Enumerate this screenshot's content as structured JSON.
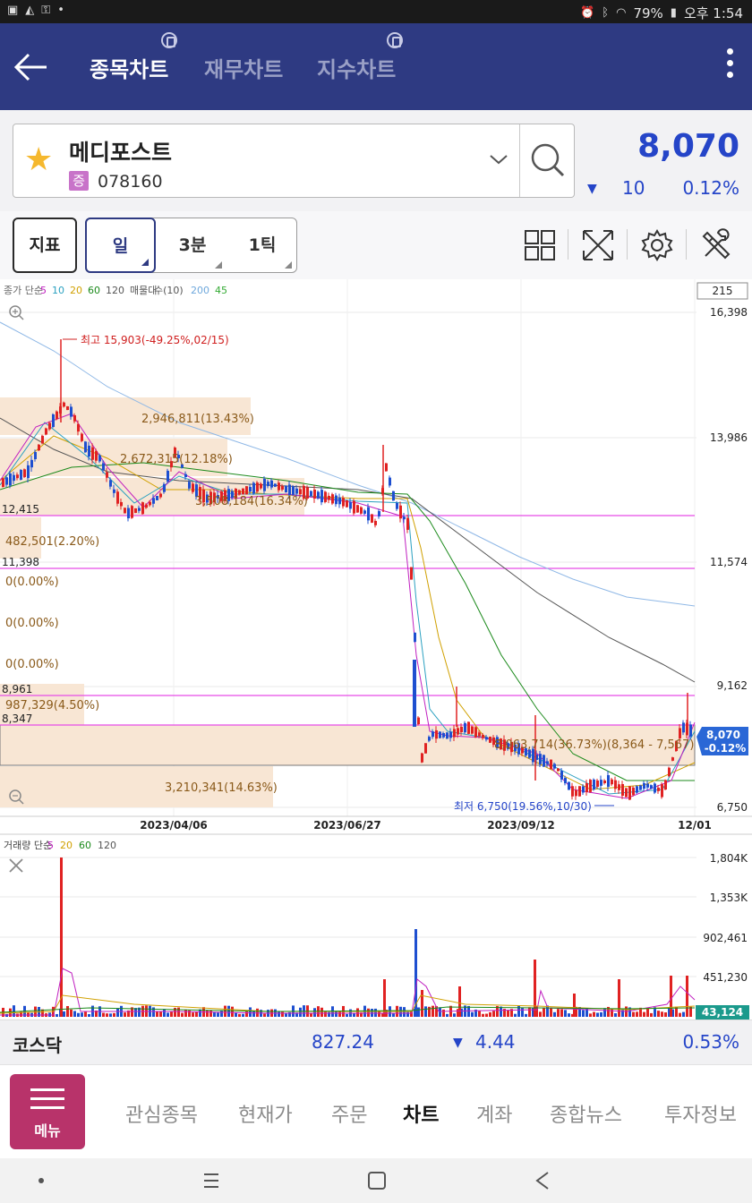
{
  "status_bar": {
    "left_icons": [
      "talk-icon",
      "signal-off-icon",
      "key-icon",
      "dot-icon"
    ],
    "battery": "79%",
    "time": "오후 1:54"
  },
  "header": {
    "tabs": [
      {
        "label": "종목차트",
        "active": true
      },
      {
        "label": "재무차트",
        "active": false
      },
      {
        "label": "지수차트",
        "active": false
      }
    ]
  },
  "stock": {
    "name": "메디포스트",
    "market_badge": "증",
    "code": "078160",
    "price": "8,070",
    "change": "10",
    "change_direction": "down",
    "percent": "0.12%"
  },
  "toolbar": {
    "indicator_label": "지표",
    "periods": [
      {
        "label": "일",
        "active": true
      },
      {
        "label": "3분",
        "active": false
      },
      {
        "label": "1틱",
        "active": false
      }
    ]
  },
  "chart": {
    "legend": [
      "종가 단순",
      "5",
      "10",
      "20",
      "60",
      "120",
      "매물대",
      "수(10)",
      "200",
      "45"
    ],
    "legend_colors": [
      "#666666",
      "#c020c0",
      "#2aa0c0",
      "#d0a000",
      "#1b8a1b",
      "#555555",
      "#555555",
      "#555555",
      "#6fa8dc",
      "#33aa33"
    ],
    "count_box": "215",
    "y_labels": [
      "16,398",
      "13,986",
      "11,574",
      "9,162",
      "6,750"
    ],
    "left_levels": [
      "12,415",
      "11,398",
      "8,961",
      "8,347"
    ],
    "x_labels": [
      "2023/04/06",
      "2023/06/27",
      "2023/09/12",
      "12/01"
    ],
    "annotations": {
      "high": "최고 15,903(-49.25%,02/15)",
      "low": "최저 6,750(19.56%,10/30)"
    },
    "volume_profile": [
      "2,946,811(13.43%)",
      "2,672,315(12.18%)",
      "3,508,184(16.34%)",
      "482,501(2.20%)",
      "0(0.00%)",
      "0(0.00%)",
      "0(0.00%)",
      "987,329(4.50%)",
      "8,063,714(36.73%)(8,364 - 7,567)",
      "3,210,341(14.63%)"
    ],
    "price_tag": {
      "price": "8,070",
      "pct": "-0.12%"
    },
    "volume": {
      "legend": [
        "거래량 단순",
        "5",
        "20",
        "60",
        "120"
      ],
      "legend_colors": [
        "#444444",
        "#c020c0",
        "#d0a000",
        "#1b8a1b",
        "#555555"
      ],
      "y_labels": [
        "1,804K",
        "1,353K",
        "902,461",
        "451,230"
      ],
      "last": "43,124"
    }
  },
  "kosdaq": {
    "name": "코스닥",
    "value": "827.24",
    "change": "4.44",
    "change_direction": "down",
    "percent": "0.53%"
  },
  "bottom_nav": {
    "menu_label": "메뉴",
    "items": [
      {
        "label": "관심종목",
        "active": false
      },
      {
        "label": "현재가",
        "active": false
      },
      {
        "label": "주문",
        "active": false
      },
      {
        "label": "차트",
        "active": true
      },
      {
        "label": "계좌",
        "active": false
      },
      {
        "label": "종합뉴스",
        "active": false
      },
      {
        "label": "투자정보",
        "active": false
      }
    ]
  }
}
